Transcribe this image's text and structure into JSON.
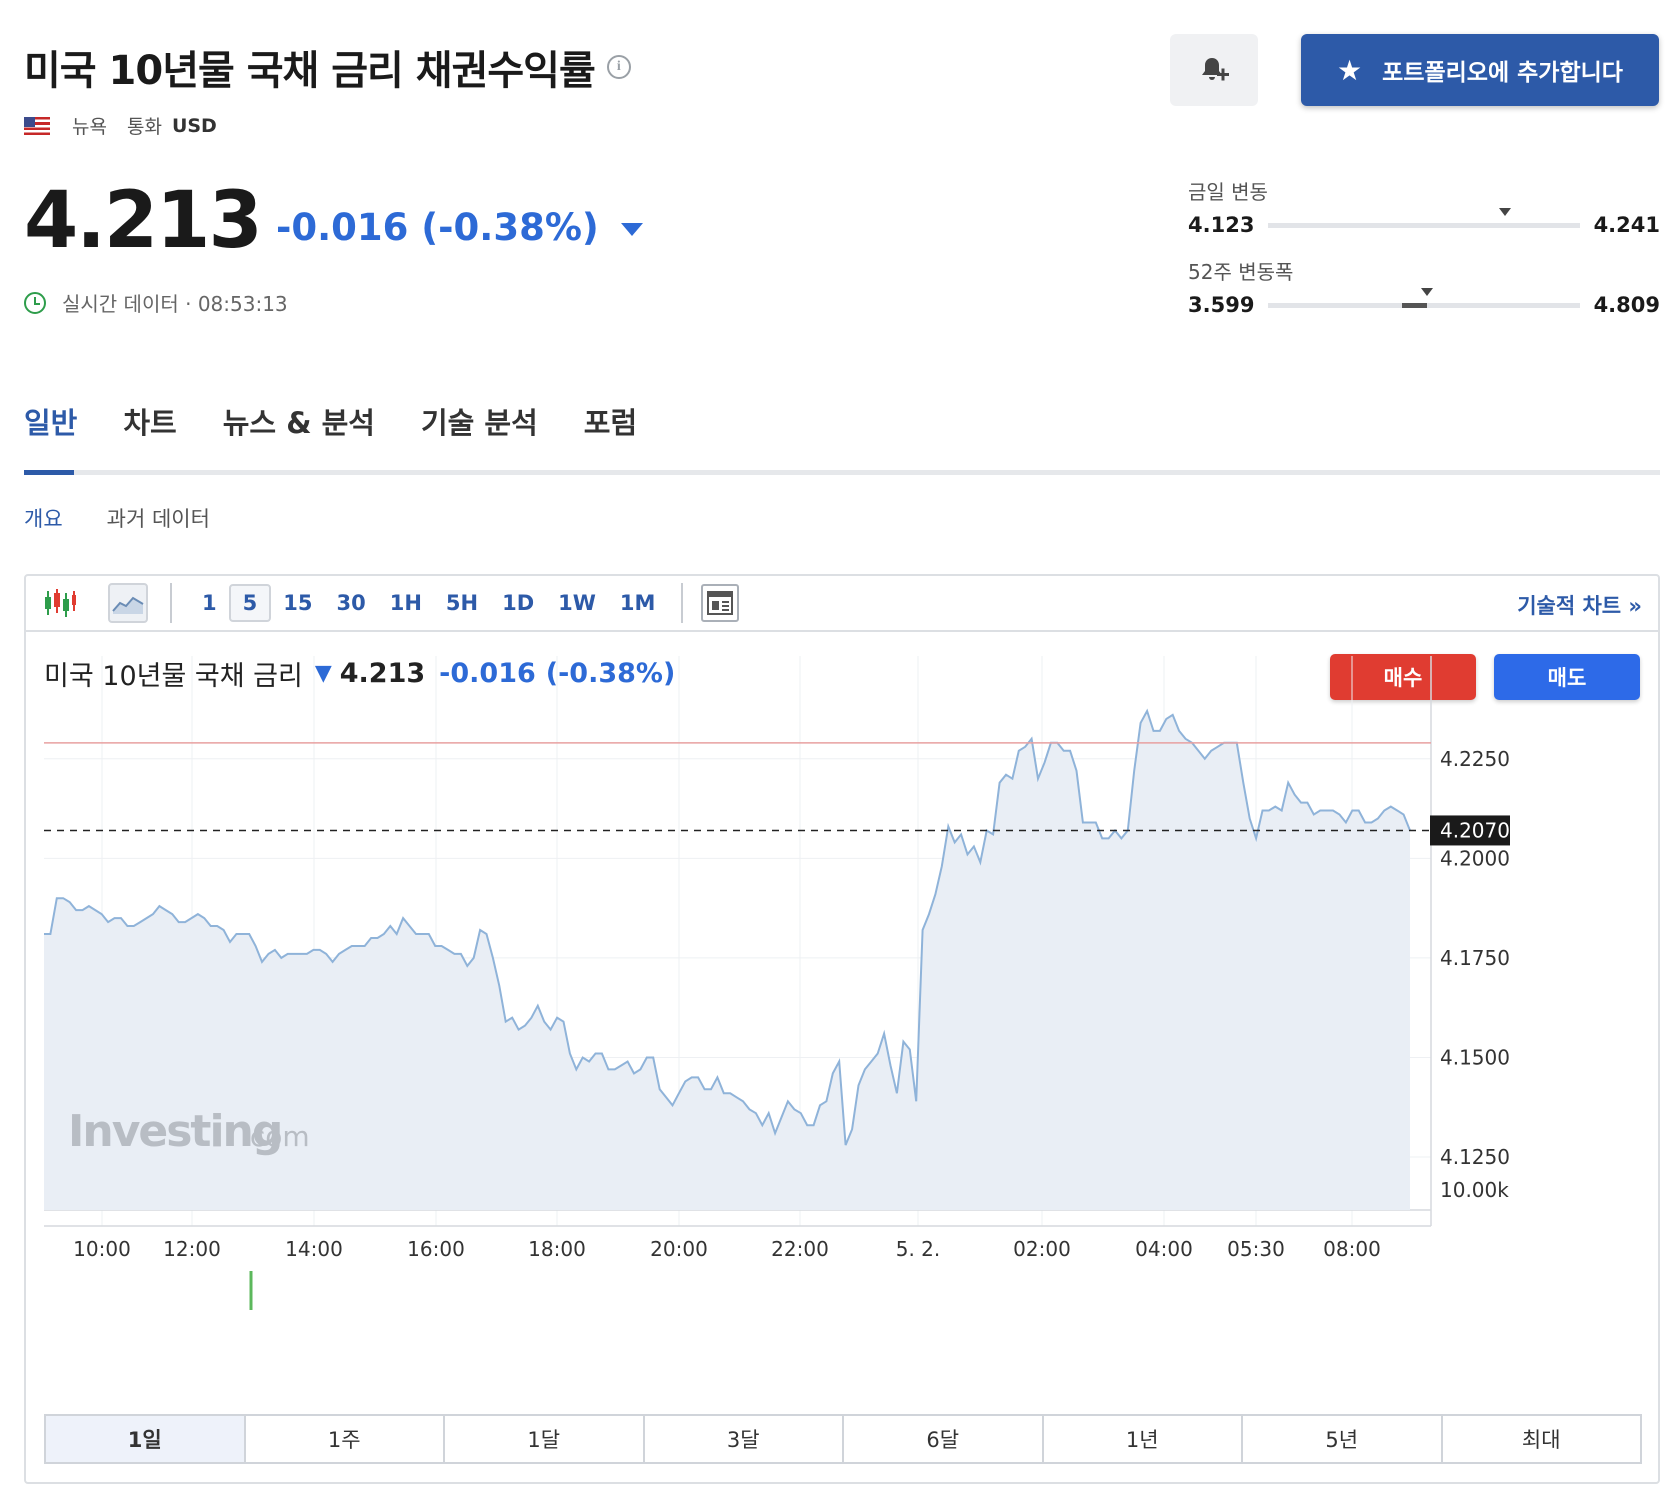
{
  "header": {
    "title": "미국 10년물 국채 금리 채권수익률",
    "exchange": "뉴욕",
    "currency_label": "통화",
    "currency": "USD",
    "portfolio_button": "포트폴리오에 추가합니다"
  },
  "quote": {
    "price": "4.213",
    "change": "-0.016 (-0.38%)",
    "realtime_label": "실시간 데이터 · 08:53:13"
  },
  "day_range": {
    "label": "금일 변동",
    "low": "4.123",
    "high": "4.241",
    "marker_fraction": 0.76
  },
  "week52_range": {
    "label": "52주 변동폭",
    "low": "3.599",
    "high": "4.809",
    "marker_fraction": 0.51,
    "band_from": 0.43,
    "band_to": 0.51
  },
  "tabs": [
    "일반",
    "차트",
    "뉴스 & 분석",
    "기술 분석",
    "포럼"
  ],
  "subtabs": [
    "개요",
    "과거 데이터"
  ],
  "toolbar": {
    "intervals": [
      "1",
      "5",
      "15",
      "30",
      "1H",
      "5H",
      "1D",
      "1W",
      "1M"
    ],
    "active_interval": "5",
    "tech_chart_link": "기술적 차트 »"
  },
  "chart_legend": {
    "name": "미국 10년물 국채 금리",
    "price": "4.213",
    "change": "-0.016",
    "change_pct": "(-0.38%)"
  },
  "buttons": {
    "buy": "매수",
    "sell": "매도"
  },
  "watermark": {
    "brand": "Investing",
    "suffix": ".com"
  },
  "range_buttons": [
    "1일",
    "1주",
    "1달",
    "3달",
    "6달",
    "1년",
    "5년",
    "최대"
  ],
  "active_range": "1일",
  "colors": {
    "accent": "#2d5aa8",
    "down": "#2d6ad6",
    "buy": "#e03c31",
    "sell": "#2d6ae8",
    "line": "#8fb3d9",
    "area": "#e9eef5"
  },
  "chart_data": {
    "type": "area",
    "x_ticks": [
      "10:00",
      "12:00",
      "14:00",
      "16:00",
      "18:00",
      "20:00",
      "22:00",
      "5. 2.",
      "02:00",
      "04:00",
      "05:30",
      "08:00"
    ],
    "y_ticks": [
      "4.2250",
      "4.2000",
      "4.1750",
      "4.1500",
      "4.1250"
    ],
    "volume_tick": "10.00k",
    "ylim": [
      4.1215,
      4.2508
    ],
    "current_label": "4.2070",
    "current_value": 4.207,
    "previous_close": 4.229,
    "series": [
      {
        "values": [
          4.181,
          4.181,
          4.19,
          4.19,
          4.189,
          4.187,
          4.187,
          4.188,
          4.187,
          4.186,
          4.184,
          4.185,
          4.185,
          4.183,
          4.183,
          4.184,
          4.185,
          4.186,
          4.188,
          4.187,
          4.186,
          4.184,
          4.184,
          4.185,
          4.186,
          4.185,
          4.183,
          4.183,
          4.182,
          4.179,
          4.181,
          4.181,
          4.181,
          4.178,
          4.174,
          4.176,
          4.177,
          4.175,
          4.176,
          4.176,
          4.176,
          4.176,
          4.177,
          4.177,
          4.176,
          4.174,
          4.176,
          4.177,
          4.178,
          4.178,
          4.178,
          4.18,
          4.18,
          4.181,
          4.183,
          4.181,
          4.185,
          4.183,
          4.181,
          4.181,
          4.181,
          4.178,
          4.178,
          4.177,
          4.176,
          4.176,
          4.173,
          4.175,
          4.182,
          4.181,
          4.175,
          4.168,
          4.159,
          4.16,
          4.157,
          4.158,
          4.16,
          4.163,
          4.159,
          4.157,
          4.16,
          4.159,
          4.151,
          4.147,
          4.15,
          4.149,
          4.151,
          4.151,
          4.147,
          4.147,
          4.148,
          4.149,
          4.146,
          4.147,
          4.15,
          4.15,
          4.142,
          4.14,
          4.138,
          4.141,
          4.144,
          4.145,
          4.145,
          4.142,
          4.142,
          4.145,
          4.141,
          4.141,
          4.14,
          4.139,
          4.137,
          4.136,
          4.133,
          4.136,
          4.131,
          4.135,
          4.139,
          4.137,
          4.136,
          4.133,
          4.133,
          4.138,
          4.139,
          4.146,
          4.149,
          4.128,
          4.132,
          4.143,
          4.147,
          4.149,
          4.151,
          4.156,
          4.148,
          4.141,
          4.154,
          4.152,
          4.139,
          4.182,
          4.186,
          4.191,
          4.198,
          4.208,
          4.204,
          4.206,
          4.201,
          4.203,
          4.199,
          4.207,
          4.206,
          4.219,
          4.221,
          4.22,
          4.227,
          4.228,
          4.23,
          4.22,
          4.224,
          4.229,
          4.229,
          4.227,
          4.227,
          4.222,
          4.209,
          4.209,
          4.209,
          4.205,
          4.205,
          4.207,
          4.205,
          4.207,
          4.222,
          4.234,
          4.237,
          4.232,
          4.232,
          4.235,
          4.236,
          4.232,
          4.23,
          4.229,
          4.227,
          4.225,
          4.227,
          4.228,
          4.229,
          4.229,
          4.229,
          4.219,
          4.21,
          4.205,
          4.212,
          4.212,
          4.213,
          4.212,
          4.219,
          4.216,
          4.214,
          4.214,
          4.211,
          4.212,
          4.212,
          4.212,
          4.211,
          4.209,
          4.212,
          4.212,
          4.209,
          4.209,
          4.21,
          4.212,
          4.213,
          4.212,
          4.211,
          4.207
        ]
      }
    ]
  }
}
